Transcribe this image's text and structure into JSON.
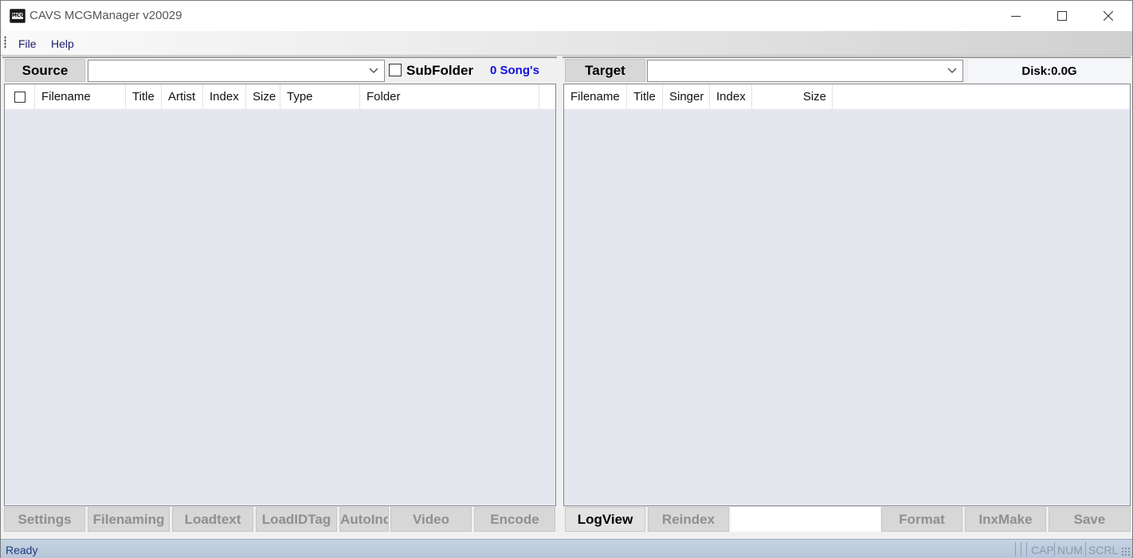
{
  "window": {
    "title": "CAVS MCGManager v20029",
    "icon_text": "MCG"
  },
  "menu": {
    "file": "File",
    "help": "Help"
  },
  "source": {
    "button": "Source",
    "combo_value": "",
    "subfolder_label": "SubFolder",
    "subfolder_checked": false,
    "song_count": "0 Song's",
    "columns": [
      "Filename",
      "Title",
      "Artist",
      "Index",
      "Size",
      "Type",
      "Folder"
    ],
    "buttons": [
      "Settings",
      "Filenaming",
      "Loadtext",
      "LoadIDTag",
      "AutoIndex",
      "Video",
      "Encode"
    ]
  },
  "target": {
    "button": "Target",
    "combo_value": "",
    "disk": "Disk:0.0G",
    "columns": [
      "Filename",
      "Title",
      "Singer",
      "Index",
      "Size"
    ],
    "buttons": [
      "LogView",
      "Reindex",
      "Format",
      "InxMake",
      "Save"
    ]
  },
  "status": {
    "text": "Ready",
    "cap": "CAP",
    "num": "NUM",
    "scrl": "SCRL"
  },
  "colors": {
    "song_count": "#1010e0",
    "list_bg": "#e5e7ef",
    "status_bar": "#c6d3e3",
    "disabled_text": "#8f8f8f"
  }
}
